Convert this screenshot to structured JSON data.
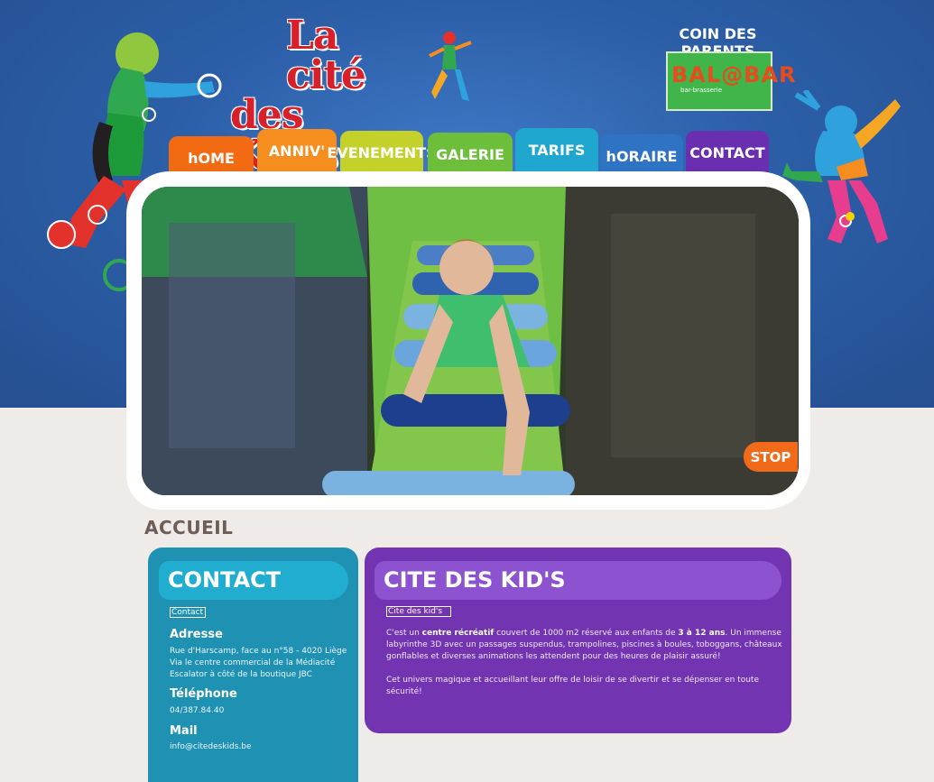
{
  "site": {
    "logo_line1": "La cité",
    "logo_line2": "des Kid's"
  },
  "header": {
    "parents_label": "COIN DES PARENTS",
    "balbar_label": "BAL@BAR",
    "balbar_sub": "bar-brasserie"
  },
  "nav": {
    "items": [
      {
        "label": "hOME",
        "color": "#f26a12"
      },
      {
        "label": "ANNIV'",
        "color": "#f58d1f"
      },
      {
        "label": "EVENEMENTS",
        "color": "#c3d12a"
      },
      {
        "label": "GALERIE",
        "color": "#6dbe3a"
      },
      {
        "label": "TARIFS",
        "color": "#1fa7cf"
      },
      {
        "label": "hORAIRE",
        "color": "#2e73c4"
      },
      {
        "label": "CONTACT",
        "color": "#6a2fb0"
      }
    ]
  },
  "slideshow": {
    "stop_label": "STOP"
  },
  "page": {
    "title": "ACCUEIL"
  },
  "contact": {
    "title": "CONTACT",
    "image_alt": "Contact",
    "address_heading": "Adresse",
    "address_line1": "Rue d'Harscamp, face au n°58 - 4020 Liège",
    "address_line2": "Via le centre commercial de la Médiacité",
    "address_line3": "Escalator à côté de la boutique JBC",
    "phone_heading": "Téléphone",
    "phone": "04/387.84.40",
    "mail_heading": "Mail",
    "mail": "info@citedeskids.be"
  },
  "main": {
    "title": "CITE DES KID'S",
    "image_alt": "Cite des kid's",
    "p1_a": "C'est un ",
    "p1_b": "centre récréatif",
    "p1_c": " couvert de 1000 m2  réservé aux enfants de ",
    "p1_d": "3 à 12 ans",
    "p1_e": ". Un immense labyrinthe 3D avec un passages suspendus, trampolines, piscines à boules, toboggans, châteaux gonflables et diverses animations les attendent pour des heures de plaisir assuré!",
    "p2": "Cet univers magique et accueillant leur offre de loisir de se divertir et se dépenser en toute sécurité!"
  }
}
